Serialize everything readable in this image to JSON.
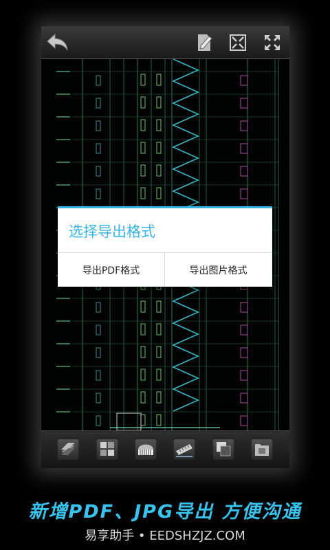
{
  "toolbar": {
    "back_icon": "back-arrow-icon",
    "edit_icon": "edit-document-icon",
    "fit_icon": "fit-screen-icon",
    "fullscreen_icon": "fullscreen-icon"
  },
  "dialog": {
    "title": "选择导出格式",
    "pdf_button": "导出PDF格式",
    "image_button": "导出图片格式",
    "accent_color": "#33b5e5"
  },
  "bottom_toolbar": {
    "icons": [
      "layers-icon",
      "layout-icon",
      "piano-icon",
      "measure-icon",
      "copy-icon",
      "folder-icon"
    ]
  },
  "caption": "新增PDF、JPG导出 方便沟通",
  "watermark": "易享助手 • EEDSHZJZ.COM"
}
